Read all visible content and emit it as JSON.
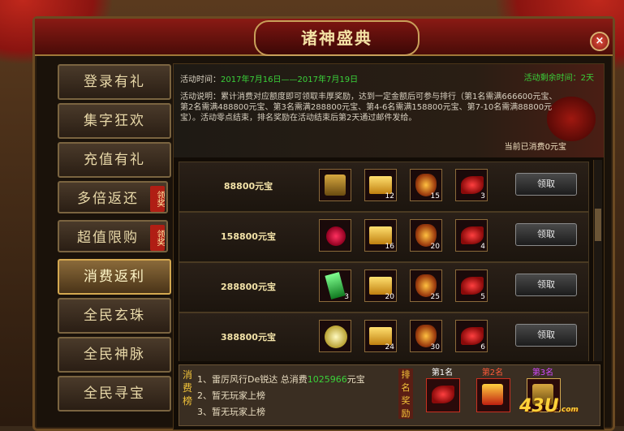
{
  "window": {
    "title": "诸神盛典",
    "close": "×"
  },
  "sidebar": {
    "items": [
      {
        "label": "登录有礼",
        "badge": ""
      },
      {
        "label": "集字狂欢",
        "badge": ""
      },
      {
        "label": "充值有礼",
        "badge": ""
      },
      {
        "label": "多倍返还",
        "badge": "领奖"
      },
      {
        "label": "超值限购",
        "badge": "领奖"
      },
      {
        "label": "消费返利",
        "badge": ""
      },
      {
        "label": "全民玄珠",
        "badge": ""
      },
      {
        "label": "全民神脉",
        "badge": ""
      },
      {
        "label": "全民寻宝",
        "badge": ""
      }
    ],
    "active_index": 5
  },
  "info": {
    "time_label": "活动时间：",
    "time_value": "2017年7月16日——2017年7月19日",
    "remain": "活动剩余时间：2天",
    "desc": "活动说明：累计消费对应额度即可领取丰厚奖励，达到一定金额后可参与排行（第1名需满666600元宝、第2名需满488800元宝、第3名需满288800元宝、第4-6名需满158800元宝、第7-10名需满88800元宝）。活动零点结束，排名奖励在活动结束后第2天通过邮件发给。",
    "current": "当前已消费0元宝"
  },
  "rows": [
    {
      "amount": "88800元宝",
      "slots": [
        {
          "icon": "chest-icon",
          "count": ""
        },
        {
          "icon": "gold-ingot-icon",
          "count": "12"
        },
        {
          "icon": "shield-icon",
          "count": "15"
        },
        {
          "icon": "wing-icon",
          "count": "3"
        }
      ],
      "button": "领取"
    },
    {
      "amount": "158800元宝",
      "slots": [
        {
          "icon": "ring-icon",
          "count": ""
        },
        {
          "icon": "gold-ingot-icon",
          "count": "16"
        },
        {
          "icon": "shield-icon",
          "count": "20"
        },
        {
          "icon": "wing-icon",
          "count": "4"
        }
      ],
      "button": "领取"
    },
    {
      "amount": "288800元宝",
      "slots": [
        {
          "icon": "crystal-icon",
          "count": "3"
        },
        {
          "icon": "gold-ingot-icon",
          "count": "20"
        },
        {
          "icon": "shield-icon",
          "count": "25"
        },
        {
          "icon": "wing-icon",
          "count": "5"
        }
      ],
      "button": "领取"
    },
    {
      "amount": "388800元宝",
      "slots": [
        {
          "icon": "orb-icon",
          "count": ""
        },
        {
          "icon": "gold-ingot-icon",
          "count": "24"
        },
        {
          "icon": "shield-icon",
          "count": "30"
        },
        {
          "icon": "wing-icon",
          "count": "6"
        }
      ],
      "button": "领取"
    }
  ],
  "ranking": {
    "label": "消费榜",
    "entries": [
      {
        "rank": "1、",
        "text": "雷厉风行De锐达 总消费",
        "value": "1025966",
        "unit": "元宝"
      },
      {
        "rank": "2、",
        "text": "暂无玩家上榜",
        "value": "",
        "unit": ""
      },
      {
        "rank": "3、",
        "text": "暂无玩家上榜",
        "value": "",
        "unit": ""
      }
    ]
  },
  "prizes": {
    "label": "排名奖励",
    "items": [
      {
        "title": "第1名",
        "color": "#ffffff",
        "icon": "character-icon"
      },
      {
        "title": "第2名",
        "color": "#ff5a3a",
        "icon": "gift-box-icon"
      },
      {
        "title": "第3名",
        "color": "#d24aff",
        "icon": "chest-icon"
      }
    ],
    "third_count": "2"
  },
  "watermark": {
    "text": "43U",
    "suffix": ".com"
  }
}
